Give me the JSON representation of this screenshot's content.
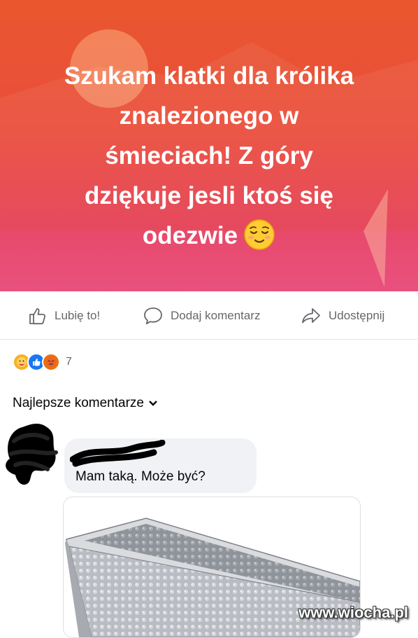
{
  "post": {
    "text_lines": [
      "Szukam klatki dla królika",
      "znalezionego w",
      "śmieciach! Z góry",
      "dziękuje jesli ktoś się",
      "odezwie"
    ],
    "emoji": "relieved-face-emoji",
    "background_colors": [
      "#e9572f",
      "#e53e55",
      "#e94b7a"
    ]
  },
  "actions": {
    "like_label": "Lubię to!",
    "comment_label": "Dodaj komentarz",
    "share_label": "Udostępnij"
  },
  "reactions": {
    "icons": [
      "care-reaction-icon",
      "like-reaction-icon",
      "angry-reaction-icon"
    ],
    "count": "7"
  },
  "comments_section": {
    "sort_label": "Najlepsze komentarze"
  },
  "comment": {
    "author_redacted": true,
    "text": "Mam taką. Może być?",
    "attachment": "loaf-pan-image"
  },
  "watermark": "www.wiocha.pl",
  "colors": {
    "text_secondary": "#65676b",
    "bubble": "#f0f2f5",
    "accent": "#1877f2"
  }
}
